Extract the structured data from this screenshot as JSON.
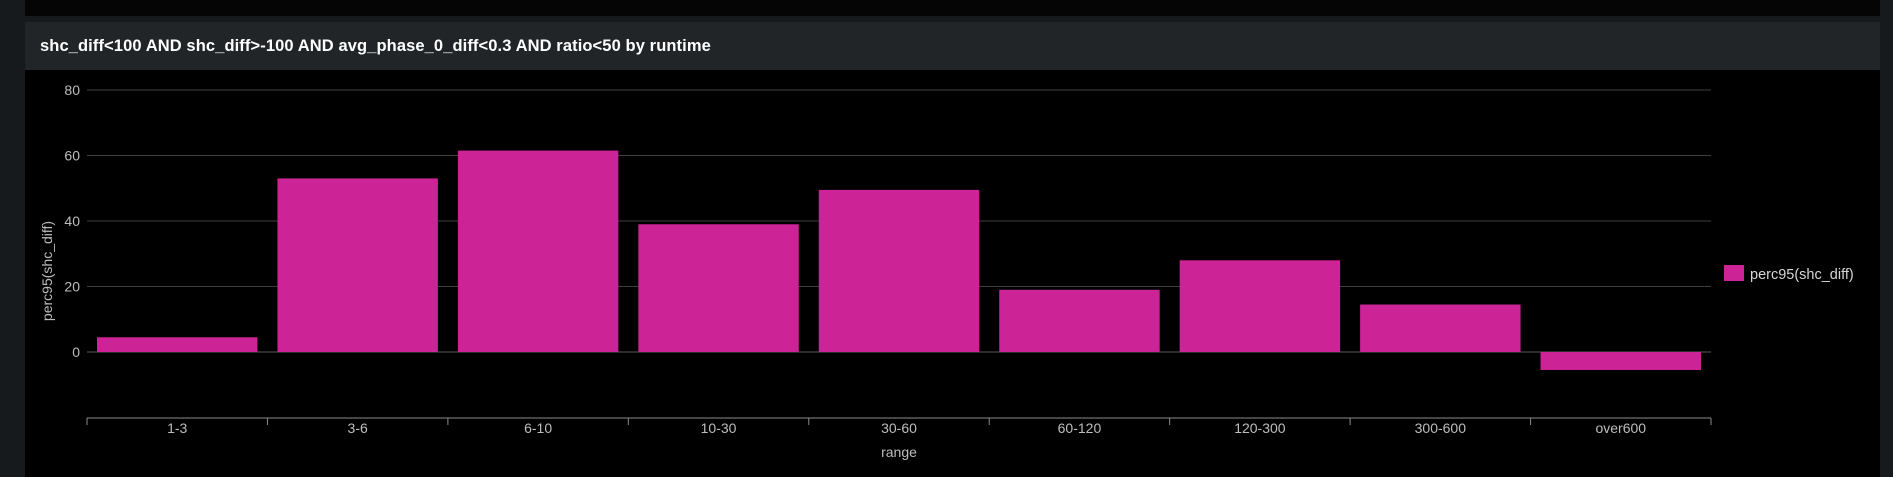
{
  "panel": {
    "title": "shc_diff<100 AND shc_diff>-100 AND avg_phase_0_diff<0.3 AND ratio<50 by runtime"
  },
  "colors": {
    "bar": "#cc2396",
    "background": "#000000",
    "header": "#212527",
    "grid": "#3c3f41",
    "axis_text": "#bdbdbd"
  },
  "chart_data": {
    "type": "bar",
    "categories": [
      "1-3",
      "3-6",
      "6-10",
      "10-30",
      "30-60",
      "60-120",
      "120-300",
      "300-600",
      "over600"
    ],
    "series": [
      {
        "name": "perc95(shc_diff)",
        "values": [
          4.5,
          53,
          61.5,
          39,
          49.5,
          19,
          28,
          14.5,
          -5.5
        ]
      }
    ],
    "xlabel": "range",
    "ylabel": "perc95(shc_diff)",
    "ylim": [
      -20,
      80
    ],
    "yticks": [
      0,
      20,
      40,
      60,
      80
    ],
    "grid": true,
    "legend_position": "right"
  }
}
